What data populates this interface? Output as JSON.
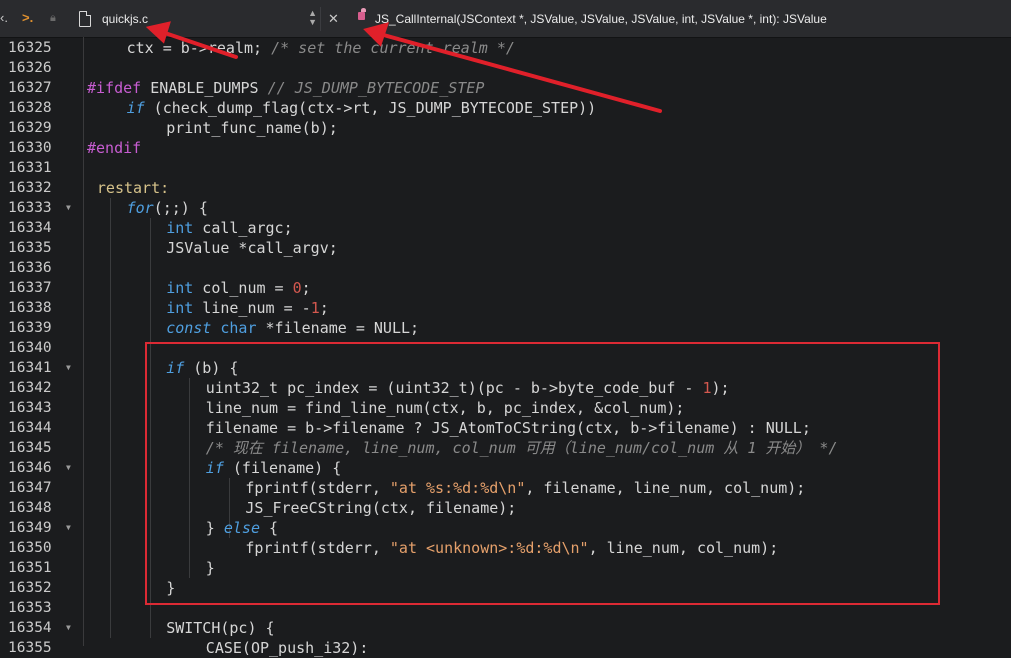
{
  "toolbar": {
    "file_name": "quickjs.c",
    "function_signature": "JS_CallInternal(JSContext *, JSValue, JSValue, JSValue, int, JSValue *, int): JSValue"
  },
  "lines": [
    {
      "num": "16325",
      "text": "ctx = b->realm; /* set the current realm */"
    },
    {
      "num": "16326",
      "text": ""
    },
    {
      "num": "16327",
      "text": "#ifdef ENABLE_DUMPS // JS_DUMP_BYTECODE_STEP"
    },
    {
      "num": "16328",
      "text": "if (check_dump_flag(ctx->rt, JS_DUMP_BYTECODE_STEP))"
    },
    {
      "num": "16329",
      "text": "print_func_name(b);"
    },
    {
      "num": "16330",
      "text": "#endif"
    },
    {
      "num": "16331",
      "text": ""
    },
    {
      "num": "16332",
      "text": "restart:"
    },
    {
      "num": "16333",
      "text": "for(;;) {",
      "fold": true
    },
    {
      "num": "16334",
      "text": "int call_argc;"
    },
    {
      "num": "16335",
      "text": "JSValue *call_argv;"
    },
    {
      "num": "16336",
      "text": ""
    },
    {
      "num": "16337",
      "text": "int col_num = 0;"
    },
    {
      "num": "16338",
      "text": "int line_num = -1;"
    },
    {
      "num": "16339",
      "text": "const char *filename = NULL;"
    },
    {
      "num": "16340",
      "text": ""
    },
    {
      "num": "16341",
      "text": "if (b) {",
      "fold": true
    },
    {
      "num": "16342",
      "text": "uint32_t pc_index = (uint32_t)(pc - b->byte_code_buf - 1);"
    },
    {
      "num": "16343",
      "text": "line_num = find_line_num(ctx, b, pc_index, &col_num);"
    },
    {
      "num": "16344",
      "text": "filename = b->filename ? JS_AtomToCString(ctx, b->filename) : NULL;"
    },
    {
      "num": "16345",
      "text": "/* 现在 filename, line_num, col_num 可用（line_num/col_num 从 1 开始） */"
    },
    {
      "num": "16346",
      "text": "if (filename) {",
      "fold": true
    },
    {
      "num": "16347",
      "text": "fprintf(stderr, \"at %s:%d:%d\\n\", filename, line_num, col_num);"
    },
    {
      "num": "16348",
      "text": "JS_FreeCString(ctx, filename);"
    },
    {
      "num": "16349",
      "text": "} else {",
      "fold": true
    },
    {
      "num": "16350",
      "text": "fprintf(stderr, \"at <unknown>:%d:%d\\n\", line_num, col_num);"
    },
    {
      "num": "16351",
      "text": "}"
    },
    {
      "num": "16352",
      "text": "}"
    },
    {
      "num": "16353",
      "text": ""
    },
    {
      "num": "16354",
      "text": "SWITCH(pc) {",
      "fold": true
    },
    {
      "num": "16355",
      "text": "CASE(OP_push_i32):"
    }
  ],
  "colors": {
    "keyword": "#4f9fe0",
    "preprocessor": "#c85dd2",
    "comment": "#8a8a8a",
    "string": "#e5a06b",
    "number": "#d4584f",
    "highlight_box": "#dc2a34",
    "arrows": "#e0202a"
  }
}
